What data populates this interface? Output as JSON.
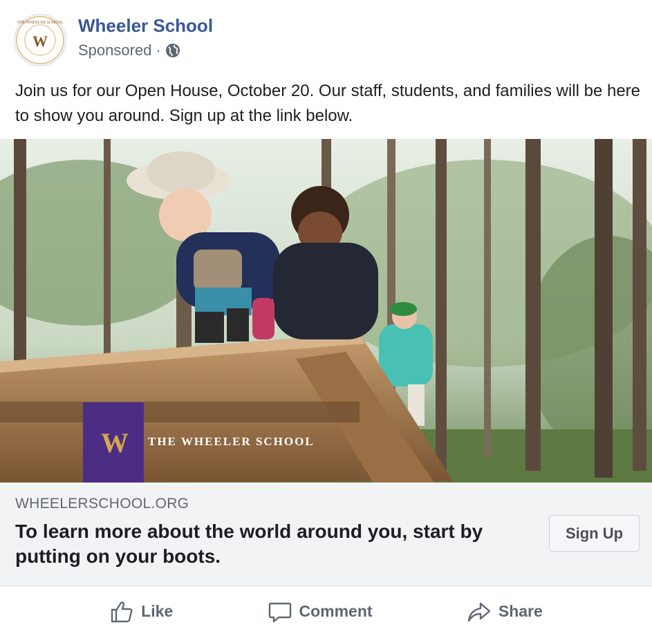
{
  "post": {
    "page_name": "Wheeler School",
    "sponsored_label": "Sponsored",
    "separator": "·",
    "audience_icon": "globe-icon",
    "body_text": "Join us for our Open House, October 20. Our staff, students, and families will be here to show you around. Sign up at the link below."
  },
  "image": {
    "brand_monogram": "W",
    "brand_wordmark": "THE WHEELER SCHOOL",
    "brand_colors": {
      "purple": "#4b2e83",
      "gold": "#d6a64f"
    }
  },
  "link_card": {
    "domain": "WHEELERSCHOOL.ORG",
    "headline": "To learn more about the world around you, start by putting on your boots.",
    "cta_label": "Sign Up"
  },
  "actions": {
    "like": "Like",
    "comment": "Comment",
    "share": "Share"
  },
  "colors": {
    "link_blue": "#385898",
    "secondary_text": "#606770",
    "panel_gray": "#f2f3f5"
  }
}
